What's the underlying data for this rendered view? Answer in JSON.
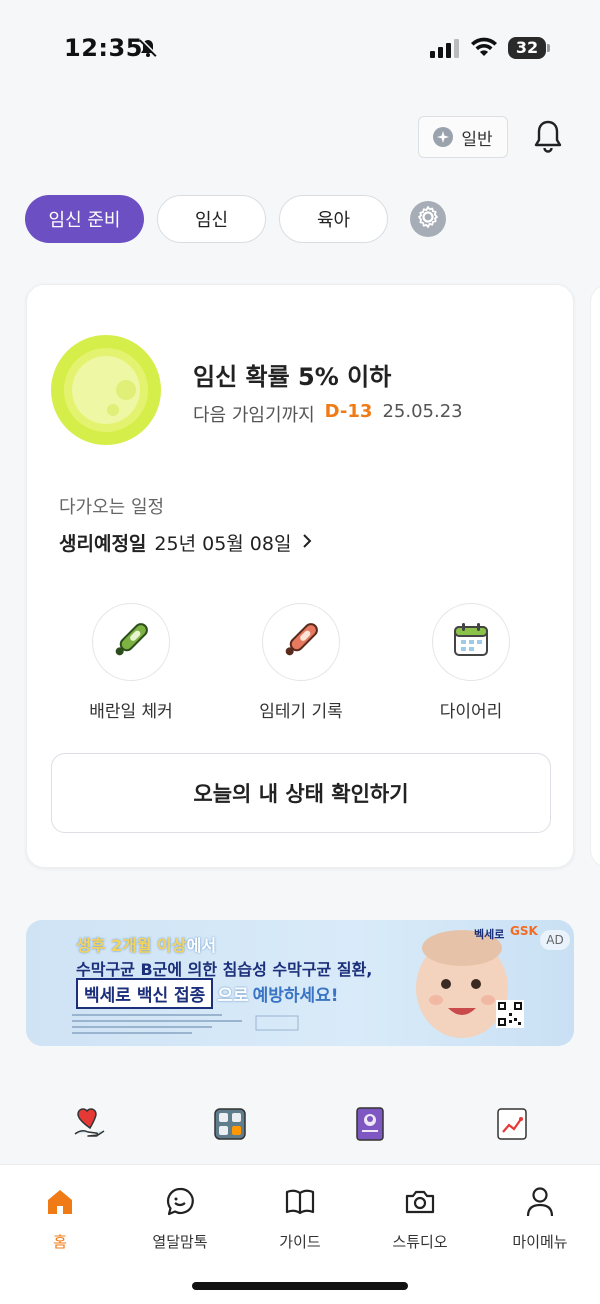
{
  "status_bar": {
    "time": "12:35",
    "battery": "32"
  },
  "header": {
    "mode_label": "일반"
  },
  "segments": [
    {
      "label": "임신 준비",
      "active": true
    },
    {
      "label": "임신",
      "active": false
    },
    {
      "label": "육아",
      "active": false
    }
  ],
  "card": {
    "probability_title": "임신 확률 5% 이하",
    "fertile_prefix": "다음 가임기까지",
    "dday": "D-13",
    "fertile_date": "25.05.23",
    "upcoming_label": "다가오는 일정",
    "period_label": "생리예정일",
    "period_date": "25년 05월 08일",
    "quick_actions": [
      {
        "label": "배란일 체커",
        "icon": "ovulation-thermometer-icon"
      },
      {
        "label": "임테기 기록",
        "icon": "pregnancy-test-icon"
      },
      {
        "label": "다이어리",
        "icon": "calendar-icon"
      }
    ],
    "cta_label": "오늘의 내 상태 확인하기"
  },
  "ad": {
    "line1_a": "생후 2개월 이상",
    "line1_b": "에서",
    "line2": "수막구균 B군에 의한 침습성 수막구균 질환,",
    "line3_highlight": "벡세로 백신 접종",
    "line3_a": "으로",
    "line3_b": "예방하세요!",
    "brand": "GSK",
    "product": "벡세로",
    "badge": "AD"
  },
  "shortcuts": [
    "heart-hand-icon",
    "calculator-icon",
    "book-icon",
    "growth-chart-icon"
  ],
  "tabs": [
    {
      "label": "홈",
      "icon": "home-icon",
      "active": true
    },
    {
      "label": "열달맘톡",
      "icon": "chat-bubble-icon",
      "active": false
    },
    {
      "label": "가이드",
      "icon": "book-open-icon",
      "active": false
    },
    {
      "label": "스튜디오",
      "icon": "camera-icon",
      "active": false
    },
    {
      "label": "마이메뉴",
      "icon": "person-icon",
      "active": false
    }
  ],
  "colors": {
    "accent": "#6c4fc3",
    "highlight": "#f07b16",
    "orb": "#d6ee4a"
  }
}
